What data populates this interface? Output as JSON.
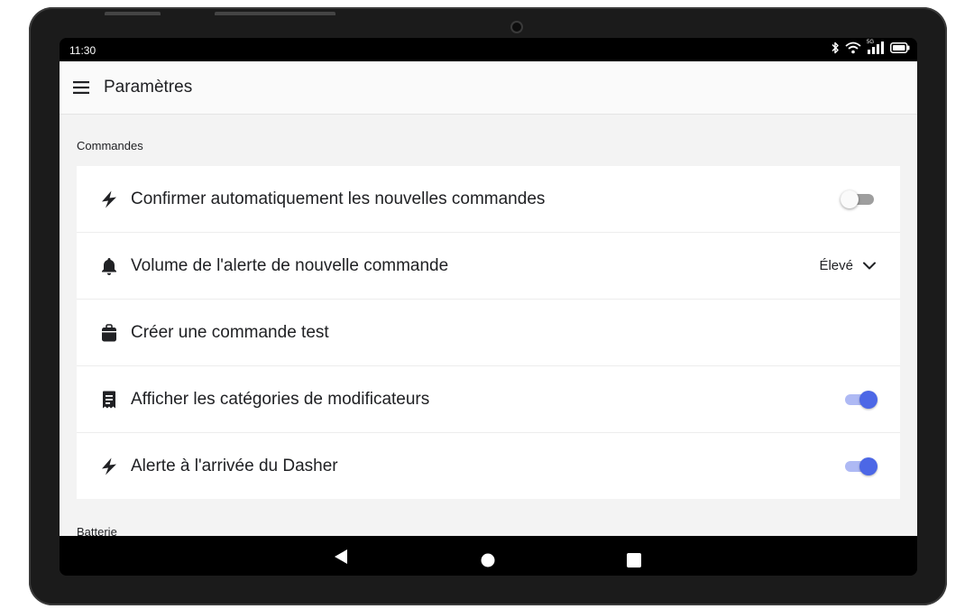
{
  "status_bar": {
    "time": "11:30",
    "icons": [
      "bluetooth-icon",
      "wifi-icon",
      "signal-icon",
      "battery-icon"
    ],
    "signal_tag": "5G"
  },
  "app_bar": {
    "menu_icon": "menu-icon",
    "title": "Paramètres"
  },
  "sections": [
    {
      "label": "Commandes",
      "items": [
        {
          "icon": "lightning-icon",
          "label": "Confirmer automatiquement les nouvelles commandes",
          "control": "toggle",
          "checked": false
        },
        {
          "icon": "bell-icon",
          "label": "Volume de l'alerte de nouvelle commande",
          "control": "select",
          "value": "Élevé"
        },
        {
          "icon": "bag-icon",
          "label": "Créer une commande test",
          "control": "none"
        },
        {
          "icon": "receipt-icon",
          "label": "Afficher les catégories de modificateurs",
          "control": "toggle",
          "checked": true
        },
        {
          "icon": "lightning-icon",
          "label": "Alerte à l'arrivée du Dasher",
          "control": "toggle",
          "checked": true
        }
      ]
    },
    {
      "label": "Batterie"
    }
  ],
  "nav_bar": {
    "buttons": [
      "back-icon",
      "home-icon",
      "recents-icon"
    ]
  },
  "colors": {
    "accent": "#4c67e6",
    "accent_track": "#aeb9f4",
    "background": "#f3f3f3",
    "card": "#ffffff",
    "bezel": "#1b1b1b"
  }
}
